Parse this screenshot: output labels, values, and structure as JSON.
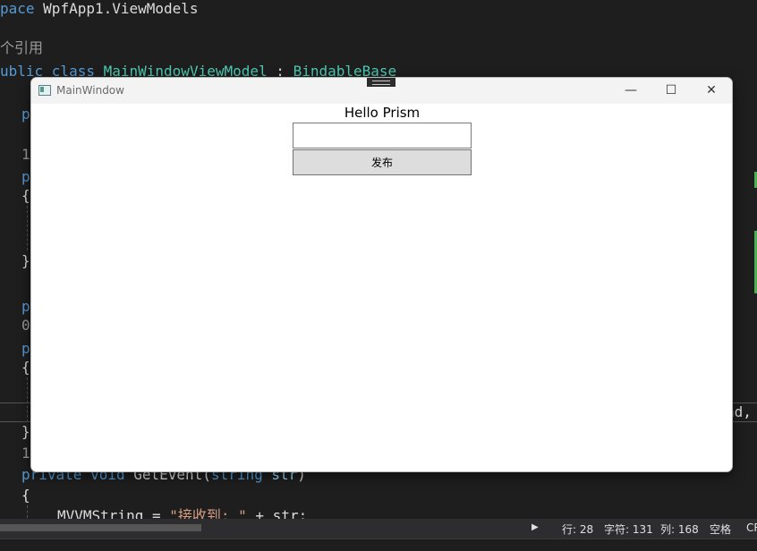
{
  "editor": {
    "line_namespace_kw": "pace",
    "line_namespace_name": "WpfApp1.ViewModels",
    "refs_label": "个引用",
    "class_line_kw": "ublic class",
    "class_name": "MainWindowViewModel",
    "class_colon": ":",
    "class_base": "BindableBase",
    "frag_p1": "p",
    "frag_1a": "1",
    "frag_p2": "p",
    "frag_brace1": "{",
    "frag_brace2": "}",
    "frag_p3": "p",
    "frag_0": "0",
    "frag_p4": "p",
    "frag_brace3": "{",
    "frag_brace4": "}",
    "frag_1b": "1",
    "method_kw": "private void",
    "method_name": "GetEvent(",
    "method_param_type": "string",
    "method_param": "str",
    "method_close": ")",
    "frag_brace5": "{",
    "assign_target": "MVVMString = ",
    "assign_string": "\"接收到: \"",
    "assign_rest": " + str;",
    "right_fragment": "ad,"
  },
  "statusbar": {
    "line": "行: 28",
    "char": "字符: 131",
    "col": "列: 168",
    "space": "空格",
    "encoding": "CR"
  },
  "window": {
    "title": "MainWindow",
    "minimize": "—",
    "maximize": "☐",
    "close": "✕",
    "hello_text": "Hello Prism",
    "input_value": "",
    "publish_button": "发布"
  },
  "colors": {
    "editor_bg": "#1e1e1e",
    "keyword": "#569cd6",
    "type": "#4ec9b0",
    "string": "#d69d85",
    "window_bg": "#ffffff",
    "button_bg": "#dddddd"
  }
}
